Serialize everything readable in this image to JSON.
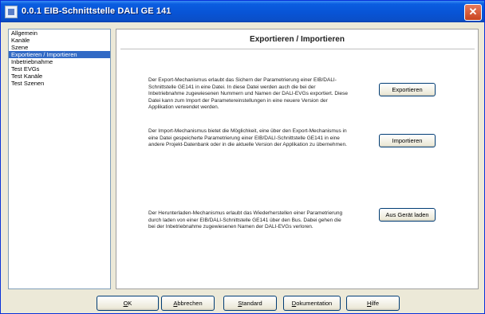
{
  "window": {
    "title": "0.0.1  EIB-Schnittstelle DALI GE 141",
    "close_glyph": "✕"
  },
  "sidebar": {
    "items": [
      {
        "label": "Allgemein",
        "selected": false
      },
      {
        "label": "Kanäle",
        "selected": false
      },
      {
        "label": "Szene",
        "selected": false
      },
      {
        "label": "Exportieren / Importieren",
        "selected": true
      },
      {
        "label": "Inbetriebnahme",
        "selected": false
      },
      {
        "label": "Test EVGs",
        "selected": false
      },
      {
        "label": "Test Kanäle",
        "selected": false
      },
      {
        "label": "Test Szenen",
        "selected": false
      }
    ]
  },
  "panel": {
    "title": "Exportieren / Importieren",
    "sections": [
      {
        "text": "Der Export-Mechanismus erlaubt das Sichern der Parametrierung einer EIB/DALI-Schnittstelle GE141 in eine Datei. In diese Datei werden auch die bei der Inbetriebnahme zugewiesenen Nummern und Namen der DALI-EVGs exportiert. Diese Datei kann zum Import der Parametereinstellungen in eine neuere Version der Applikation verwendet werden.",
        "button": "Exportieren"
      },
      {
        "text": "Der Import-Mechanismus bietet die Möglichkeit, eine über den Export-Mechanismus in eine Datei gespeicherte Parametrierung einer EIB/DALI-Schnittstelle GE141 in eine andere Projekt-Datenbank oder in die aktuelle Version der Applikation zu übernehmen.",
        "button": "Importieren"
      },
      {
        "text": "Der Herunterladen-Mechanismus erlaubt das Wiederherstellen einer Parametrierung durch laden von einer EIB/DALI-Schnittstelle GE141 über den Bus. Dabei gehen die bei der Inbetriebnahme zugewiesenen Namen der DALI-EVGs verloren.",
        "button": "Aus Gerät laden"
      }
    ]
  },
  "buttons": {
    "ok": {
      "mnemonic": "O",
      "rest": "K"
    },
    "cancel": {
      "mnemonic": "A",
      "rest": "bbrechen"
    },
    "standard": {
      "mnemonic": "S",
      "rest": "tandard"
    },
    "documentation": {
      "mnemonic": "D",
      "rest": "okumentation"
    },
    "help": {
      "mnemonic": "H",
      "rest": "ilfe"
    }
  }
}
